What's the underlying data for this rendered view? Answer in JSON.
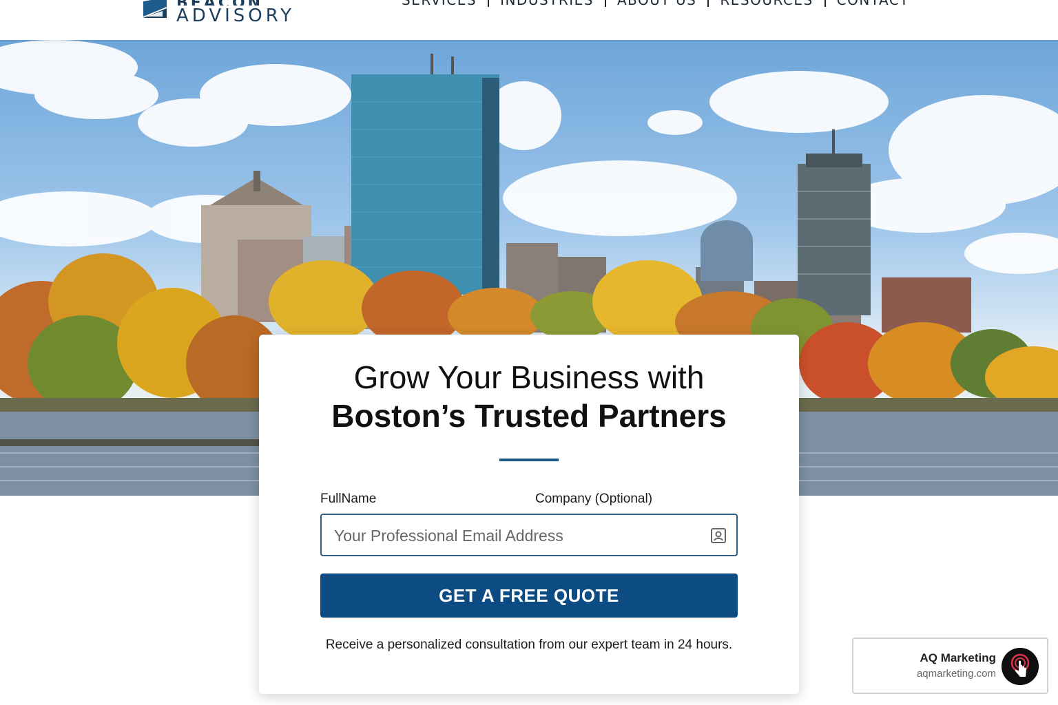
{
  "brand": {
    "name_top": "BEACON",
    "name_bottom": "ADVISORY",
    "logo_icon": "sail-icon"
  },
  "nav": {
    "items": [
      {
        "label": "SERVICES"
      },
      {
        "label": "INDUSTRIES"
      },
      {
        "label": "ABOUT US"
      },
      {
        "label": "RESOURCES"
      },
      {
        "label": "CONTACT"
      }
    ]
  },
  "hero": {
    "image": "boston-skyline-photo"
  },
  "card": {
    "title_line1": "Grow Your Business with",
    "title_line2": "Boston’s Trusted Partners",
    "label_name": "FullName",
    "label_company": "Company (Optional)",
    "email_placeholder": "Your Professional Email Address",
    "email_value": "",
    "field_icon": "contact-card-icon",
    "button_label": "GET A FREE QUOTE",
    "note": "Receive a personalized consultation from our expert team in 24 hours."
  },
  "badge": {
    "name": "AQ Marketing",
    "url": "aqmarketing.com",
    "icon": "tap-hand-icon"
  },
  "colors": {
    "primary": "#0d4c82",
    "brand_navy": "#1d3d5c",
    "rule": "#1f5a86"
  }
}
